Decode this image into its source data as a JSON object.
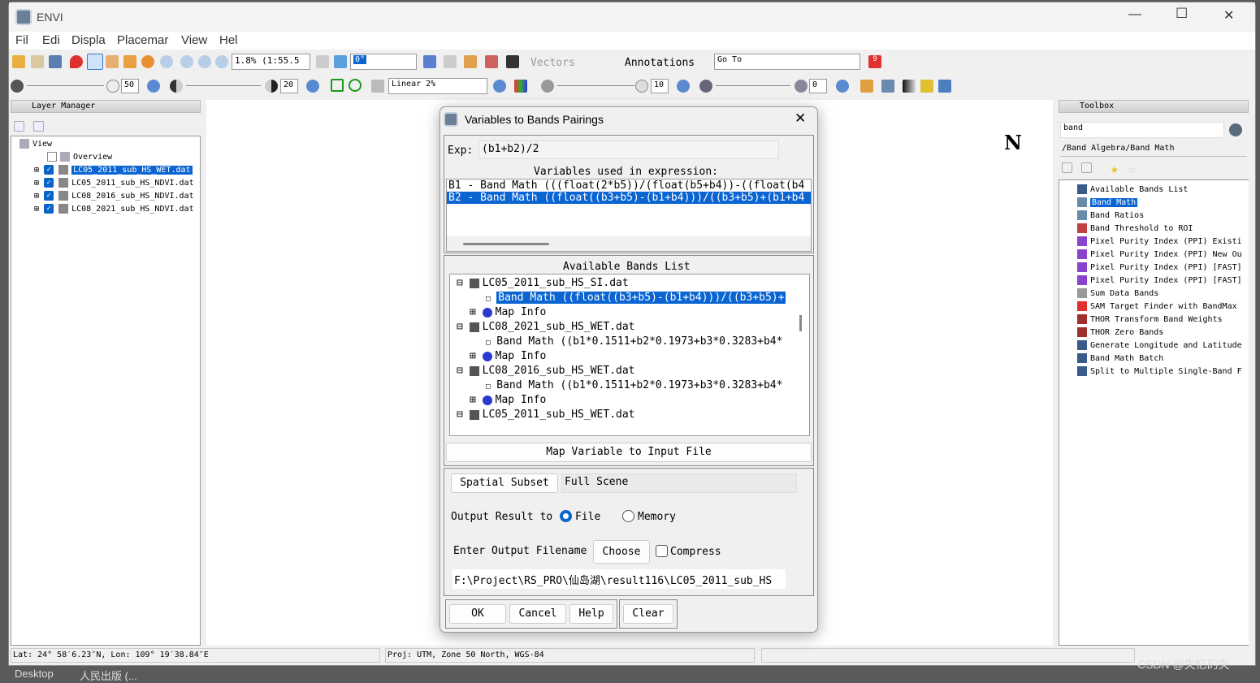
{
  "window": {
    "title": "ENVI",
    "minimize": "—",
    "maximize": "☐",
    "close": "✕"
  },
  "menu": [
    "File",
    "Edit",
    "Display",
    "Placemark",
    "View",
    "Help"
  ],
  "menu_visible": [
    "Fil",
    "Edi",
    "Displa",
    "Placemar",
    "View",
    "Hel"
  ],
  "toolbar": {
    "zoom_value": "1.8% (1:55.5",
    "rotation_value": "0°",
    "vectors_label": "Vectors",
    "annotations_label": "Annotations",
    "goto_value": "Go To",
    "brightness_value": "50",
    "contrast_value": "20",
    "stretch_value": "Linear 2%",
    "sharpen_value": "10",
    "transparency_value": "0",
    "notification_count": "9"
  },
  "layer_manager": {
    "title": "Layer Manager",
    "root": "View",
    "overview": "Overview",
    "layers": [
      {
        "name": "LC05_2011_sub_HS_WET.dat",
        "selected": true
      },
      {
        "name": "LC05_2011_sub_HS_NDVI.dat",
        "selected": false
      },
      {
        "name": "LC08_2016_sub_HS_NDVI.dat",
        "selected": false
      },
      {
        "name": "LC08_2021_sub_HS_NDVI.dat",
        "selected": false
      }
    ]
  },
  "toolbox": {
    "title": "Toolbox",
    "search_value": "band",
    "path": "/Band Algebra/Band Math",
    "items": [
      "Available Bands List",
      "Band Math",
      "Band Ratios",
      "Band Threshold to ROI",
      "Pixel Purity Index (PPI) Existi",
      "Pixel Purity Index (PPI) New Ou",
      "Pixel Purity Index (PPI) [FAST]",
      "Pixel Purity Index (PPI) [FAST]",
      "Sum Data Bands",
      "SAM Target Finder with BandMax",
      "THOR Transform Band Weights",
      "THOR Zero Bands",
      "Generate Longitude and Latitude",
      "Band Math Batch",
      "Split to Multiple Single-Band F"
    ],
    "selected_index": 1
  },
  "north_arrow": "N",
  "status": {
    "latlon": "Lat: 24° 58′6.23″N, Lon: 109° 19′38.84″E",
    "proj": "Proj: UTM, Zone 50 North, WGS-84"
  },
  "dialog": {
    "title": "Variables to Bands Pairings",
    "exp_label": "Exp:",
    "exp_value": "(b1+b2)/2",
    "vars_label": "Variables used in expression:",
    "vars": [
      "B1 - Band Math (((float(2*b5))/(float(b5+b4))-((float(b4",
      "B2 - Band Math ((float((b3+b5)-(b1+b4)))/((b3+b5)+(b1+b4"
    ],
    "bands_label": "Available Bands List",
    "bands": [
      {
        "file": "LC05_2011_sub_HS_SI.dat",
        "band": "Band Math ((float((b3+b5)-(b1+b4)))/((b3+b5)+",
        "map": "Map Info",
        "band_selected": true
      },
      {
        "file": "LC08_2021_sub_HS_WET.dat",
        "band": "Band Math ((b1*0.1511+b2*0.1973+b3*0.3283+b4*",
        "map": "Map Info",
        "band_selected": false
      },
      {
        "file": "LC08_2016_sub_HS_WET.dat",
        "band": "Band Math ((b1*0.1511+b2*0.1973+b3*0.3283+b4*",
        "map": "Map Info",
        "band_selected": false
      },
      {
        "file": "LC05_2011_sub_HS_WET.dat"
      }
    ],
    "map_var_button": "Map Variable to Input File",
    "spatial_subset_button": "Spatial Subset",
    "spatial_subset_value": "Full Scene",
    "output_label": "Output Result to",
    "output_file": "File",
    "output_memory": "Memory",
    "output_selected": "File",
    "filename_label": "Enter Output Filename",
    "choose_button": "Choose",
    "compress_label": "Compress",
    "compress_checked": false,
    "filename_value": "F:\\Project\\RS_PRO\\仙岛湖\\result116\\LC05_2011_sub_HS",
    "ok": "OK",
    "cancel": "Cancel",
    "help": "Help",
    "clear": "Clear"
  },
  "taskbar": [
    "Desktop",
    "人民出版 (..."
  ],
  "watermark": "CSDN @失忆的失"
}
